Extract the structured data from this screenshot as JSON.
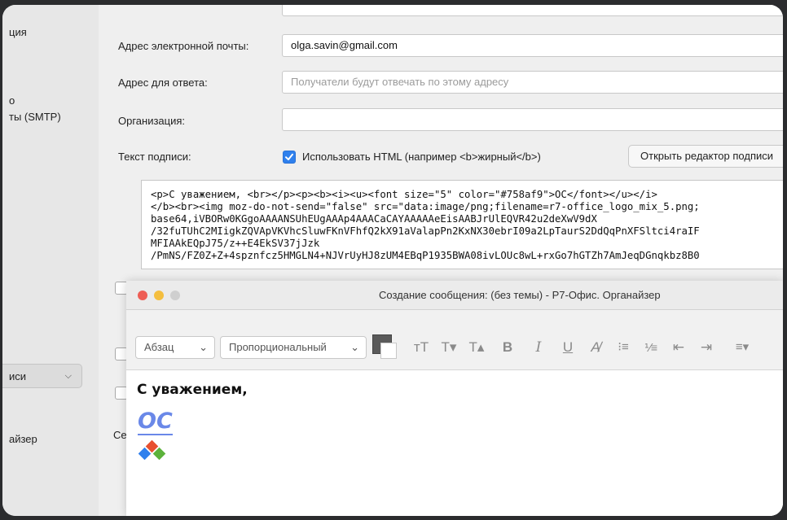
{
  "sidebar": {
    "items": [
      "ция",
      "о",
      "ты (SMTP)",
      "айзер"
    ],
    "select_label": "иси"
  },
  "form": {
    "email_label": "Адрес электронной почты:",
    "email_value": "olga.savin@gmail.com",
    "reply_label": "Адрес для ответа:",
    "reply_placeholder": "Получатели будут отвечать по этому адресу",
    "org_label": "Организация:",
    "org_value": "",
    "signature_label": "Текст подписи:",
    "use_html_label": "Использовать HTML (например <b>жирный</b>)",
    "use_html_checked": true,
    "open_editor_button": "Открыть редактор подписи",
    "signature_code": [
      "<p>С уважением, <br></p><p><b><i><u><font size=\"5\" color=\"#758af9\">OC</font></u></i>",
      "</b><br><img moz-do-not-send=\"false\" src=\"data:image/png;filename=r7-office_logo_mix_5.png;",
      "base64,iVBORw0KGgoAAAANSUhEUgAAAp4AAACaCAYAAAAAeEisAABJrUlEQVR42u2deXwV9dX",
      "/32fuTUhC2MIigkZQVApVKVhcSluwFKnVFhfQ2kX91aValapPn2KxNX30ebrI09a2LpTaurS2DdQqPnXFSltci4raIF",
      "MFIAAkEQpJ75/z++E4EkSV37jJzk",
      "/PmNS/FZ0Z+Z+4spznfcz5HMGLN4+NJVrUyHJ8zUM4EBqP1935BWA08ivLOUc8wL+rxGo7hGTZh7AmJeqDGnqkbz8B0"
    ],
    "bottom_partial_label": "Се"
  },
  "compose": {
    "title": "Создание сообщения: (без темы) - Р7-Офис. Органайзер",
    "paragraph_select": "Абзац",
    "font_select": "Пропорциональный",
    "toolbar_glyphs": {
      "size_up": "тT",
      "size_down": "T▾",
      "superscript": "T▴",
      "bold": "B",
      "italic": "I",
      "underline": "U",
      "clear": "A̸",
      "bullets": "⁝≡",
      "numbering": "⅟≡",
      "outdent": "⇤",
      "indent": "⇥",
      "align": "≡▾"
    },
    "greeting": "С уважением,",
    "logo_text": "OC"
  },
  "colors": {
    "accent": "#2f80ed",
    "logo_blue": "#6a88e8",
    "diamond_red": "#e8502f",
    "diamond_blue": "#2f80ed",
    "diamond_green": "#5cb23b"
  }
}
